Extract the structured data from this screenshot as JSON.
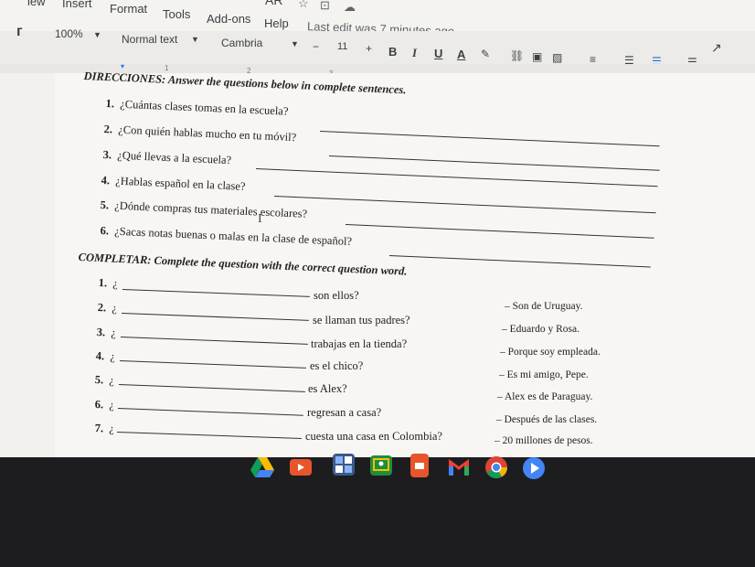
{
  "menu": {
    "partial_view": "iew",
    "insert": "Insert",
    "format": "Format",
    "tools": "Tools",
    "addons": "Add-ons",
    "help": "Help",
    "last_edit": "Last edit was 7 minutes ago",
    "partial_title": "AR"
  },
  "toolbar": {
    "zoom": "100%",
    "style": "Normal text",
    "font": "Cambria",
    "size": "11",
    "minus": "−",
    "plus": "+",
    "bold": "B",
    "italic": "I",
    "underline": "U",
    "text_color": "A"
  },
  "ruler": {
    "marks": [
      "1",
      "2",
      "3",
      "4",
      "5",
      "6",
      "7",
      "8"
    ]
  },
  "section1": {
    "heading": "DIRECCIONES: Answer the questions below in complete sentences.",
    "items": [
      {
        "num": "1.",
        "text": "¿Cuántas clases tomas en la escuela?"
      },
      {
        "num": "2.",
        "text": "¿Con quién hablas mucho en tu móvil?"
      },
      {
        "num": "3.",
        "text": "¿Qué llevas a la escuela?"
      },
      {
        "num": "4.",
        "text": "¿Hablas español en la clase?"
      },
      {
        "num": "5.",
        "text": "¿Dónde compras tus materiales escolares?"
      },
      {
        "num": "6.",
        "text": "¿Sacas notas buenas o malas en la clase de español?"
      }
    ]
  },
  "section2": {
    "heading": "COMPLETAR: Complete the question with the correct question word.",
    "items": [
      {
        "num": "1.",
        "open": "¿",
        "rest": "son ellos?",
        "answer": "– Son de Uruguay."
      },
      {
        "num": "2.",
        "open": "¿",
        "rest": "se llaman tus padres?",
        "answer": "– Eduardo y Rosa."
      },
      {
        "num": "3.",
        "open": "¿",
        "rest": "trabajas en la tienda?",
        "answer": "– Porque soy empleada."
      },
      {
        "num": "4.",
        "open": "¿",
        "rest": "es el chico?",
        "answer": "– Es mi amigo, Pepe."
      },
      {
        "num": "5.",
        "open": "¿",
        "rest": "es Alex?",
        "answer": "– Alex es de Paraguay."
      },
      {
        "num": "6.",
        "open": "¿",
        "rest": "regresan a casa?",
        "answer": "– Después de las clases."
      },
      {
        "num": "7.",
        "open": "¿",
        "rest": "cuesta una casa en Colombia?",
        "answer": "– 20 millones de pesos."
      }
    ]
  },
  "taskbar": {
    "apps": [
      "google-drive-icon",
      "youtube-icon",
      "calculator-icon",
      "classroom-icon",
      "slides-icon",
      "gmail-icon",
      "chrome-icon",
      "play-store-icon"
    ]
  }
}
